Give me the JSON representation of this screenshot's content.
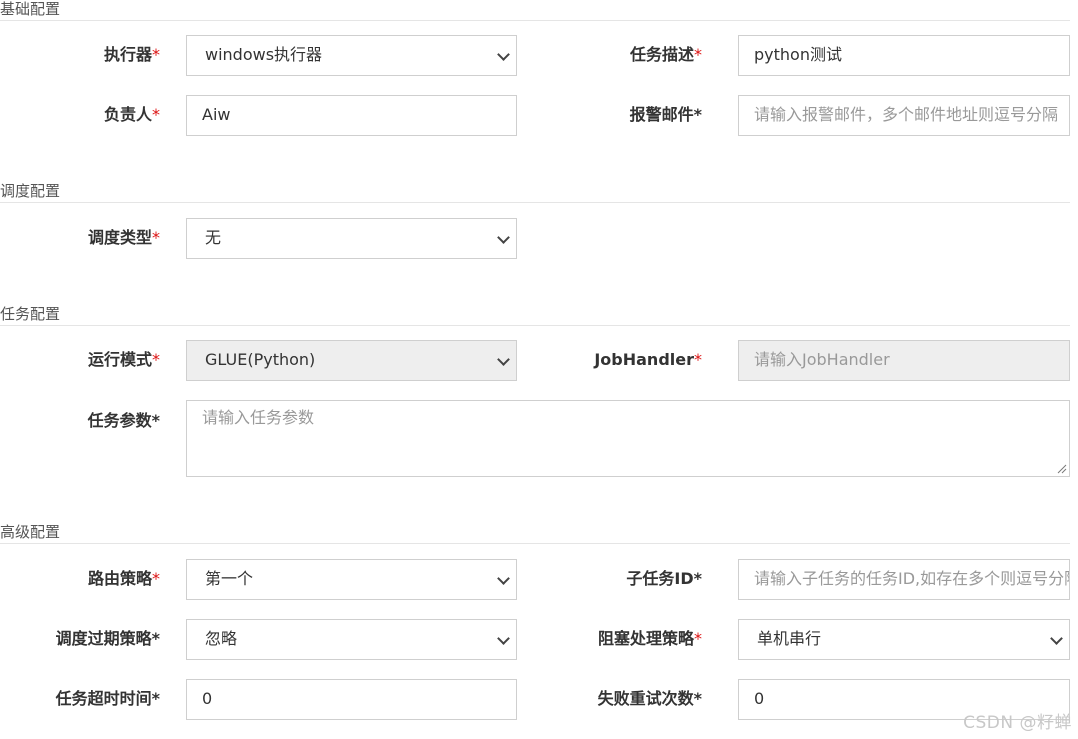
{
  "sections": {
    "basic": "基础配置",
    "schedule": "调度配置",
    "task": "任务配置",
    "advanced": "高级配置"
  },
  "fields": {
    "executor": {
      "label": "执行器",
      "value": "windows执行器"
    },
    "desc": {
      "label": "任务描述",
      "value": "python测试"
    },
    "owner": {
      "label": "负责人",
      "value": "Aiw"
    },
    "email": {
      "label": "报警邮件",
      "placeholder": "请输入报警邮件，多个邮件地址则逗号分隔"
    },
    "schedule_type": {
      "label": "调度类型",
      "value": "无"
    },
    "run_mode": {
      "label": "运行模式",
      "value": "GLUE(Python)"
    },
    "job_handler": {
      "label": "JobHandler",
      "placeholder": "请输入JobHandler"
    },
    "task_param": {
      "label": "任务参数",
      "placeholder": "请输入任务参数"
    },
    "route": {
      "label": "路由策略",
      "value": "第一个"
    },
    "child_id": {
      "label": "子任务ID",
      "placeholder": "请输入子任务的任务ID,如存在多个则逗号分隔"
    },
    "misfire": {
      "label": "调度过期策略",
      "value": "忽略"
    },
    "block": {
      "label": "阻塞处理策略",
      "value": "单机串行"
    },
    "timeout": {
      "label": "任务超时时间",
      "value": "0"
    },
    "retry": {
      "label": "失败重试次数",
      "value": "0"
    }
  },
  "required_mark": "*",
  "watermark": "CSDN @籽蝉"
}
